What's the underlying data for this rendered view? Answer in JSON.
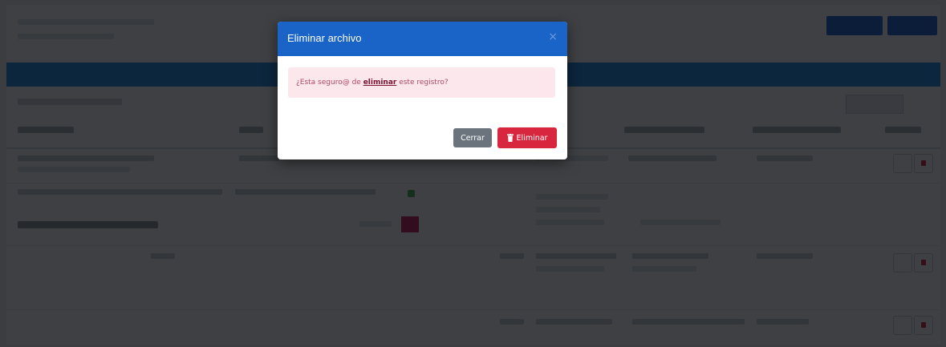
{
  "modal": {
    "title": "Eliminar archivo",
    "close_glyph": "×",
    "message_before": "¿Esta seguro@ de ",
    "message_link": "eliminar",
    "message_after": " este registro?",
    "cancel_label": "Cerrar",
    "confirm_label": "Eliminar",
    "confirm_icon": "trash-icon"
  },
  "colors": {
    "header": "#1a63c7",
    "danger": "#d7263d",
    "secondary": "#6b747d",
    "alert_bg": "#fbe7ec"
  }
}
